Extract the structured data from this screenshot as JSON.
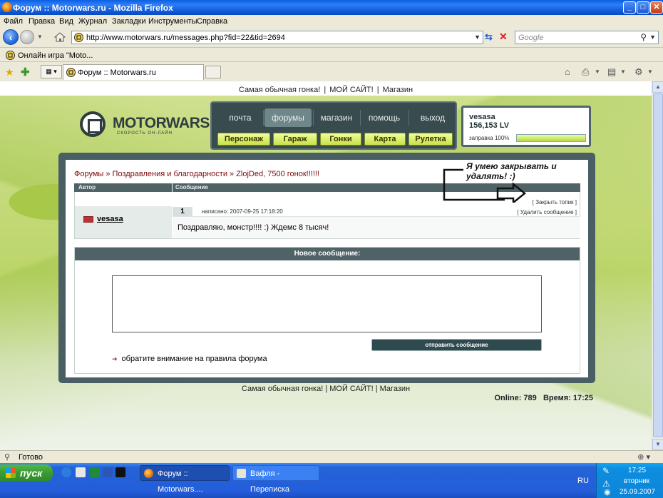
{
  "window": {
    "title": "Форум :: Motorwars.ru - Mozilla Firefox",
    "min": "_",
    "max": "□",
    "close": "✕"
  },
  "menu": [
    "Файл",
    "Правка",
    "Вид",
    "Журнал",
    "Закладки",
    "Инструменты",
    "Справка"
  ],
  "nav": {
    "url": "http://www.motorwars.ru/messages.php?fid=22&tid=2694",
    "search_placeholder": "Google"
  },
  "bookmark": "Онлайн игра \"Moto...",
  "tab": {
    "title": "Форум :: Motorwars.ru"
  },
  "site": {
    "top_links": [
      "Самая обычная гонка!",
      "МОЙ САЙТ!",
      "Магазин"
    ],
    "logo_text": "MOTORWARS.RU",
    "logo_sub": "СКОРОСТЬ ОН-ЛАЙН",
    "nav_items": [
      "почта",
      "форумы",
      "магазин",
      "помощь",
      "выход"
    ],
    "nav_active": "форумы",
    "buttons": [
      "Персонаж",
      "Гараж",
      "Гонки",
      "Карта",
      "Рулетка"
    ],
    "user": {
      "name": "vesasa",
      "lv": "156,153 LV",
      "fuel_label": "заправка 100%",
      "fuel_level": 100
    }
  },
  "forum": {
    "breadcrumbs": "Форумы » Поздравления и благодарности » ZlojDed, 7500 гонок!!!!!!",
    "col_author": "Автор",
    "col_message": "Сообщение",
    "close_topic": "[ Закрыть топик ]",
    "delete_message": "[ Удалить сообщение ]",
    "post": {
      "number": "1",
      "meta": "написано: 2007-09-25 17:18:20",
      "author": "vesasa",
      "text": "Поздравляю, монстр!!!! :) Ждемс 8 тысяч!"
    },
    "new_message_header": "Новое сообщение:",
    "send_button": "отправить сообщение",
    "rules": "обратите внимание на правила форума",
    "annotation_line1": "Я умею закрывать и",
    "annotation_line2": "удалять! :)",
    "online_label": "Online: 789",
    "time_label": "Время: 17:25"
  },
  "status": {
    "text": "Готово"
  },
  "taskbar": {
    "start": "пуск",
    "tasks": [
      "Форум :: Motorwars....",
      "Вафля - Переписка"
    ],
    "lang": "RU",
    "time": "17:25",
    "day": "вторник",
    "date": "25.09.2007"
  }
}
